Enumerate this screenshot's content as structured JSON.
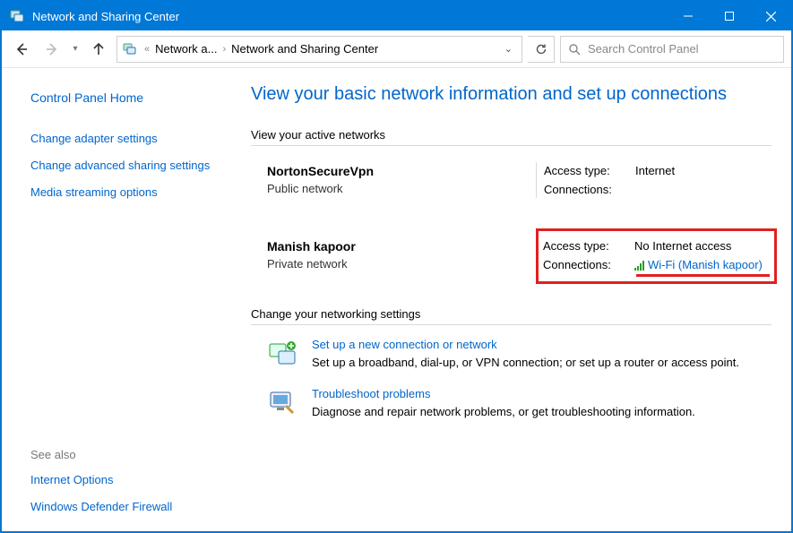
{
  "window": {
    "title": "Network and Sharing Center"
  },
  "breadcrumb": {
    "truncated": "«",
    "seg1": "Network a...",
    "seg2": "Network and Sharing Center"
  },
  "search": {
    "placeholder": "Search Control Panel"
  },
  "sidebar": {
    "home": "Control Panel Home",
    "links": [
      "Change adapter settings",
      "Change advanced sharing settings",
      "Media streaming options"
    ],
    "see_also_label": "See also",
    "see_also": [
      "Internet Options",
      "Windows Defender Firewall"
    ]
  },
  "main": {
    "title": "View your basic network information and set up connections",
    "active_header": "View your active networks",
    "networks": [
      {
        "name": "NortonSecureVpn",
        "type": "Public network",
        "access_label": "Access type:",
        "access_value": "Internet",
        "conn_label": "Connections:",
        "conn_value": ""
      },
      {
        "name": "Manish kapoor",
        "type": "Private network",
        "access_label": "Access type:",
        "access_value": "No Internet access",
        "conn_label": "Connections:",
        "conn_link": "Wi-Fi (Manish kapoor)"
      }
    ],
    "change_header": "Change your networking settings",
    "settings": [
      {
        "link": "Set up a new connection or network",
        "desc": "Set up a broadband, dial-up, or VPN connection; or set up a router or access point."
      },
      {
        "link": "Troubleshoot problems",
        "desc": "Diagnose and repair network problems, or get troubleshooting information."
      }
    ]
  }
}
